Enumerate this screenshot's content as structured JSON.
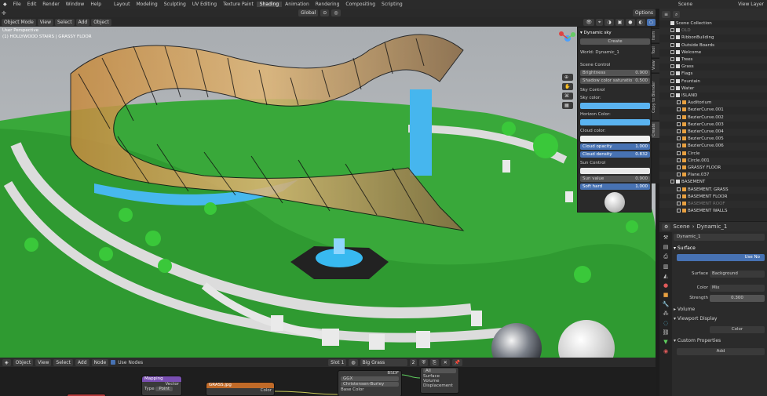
{
  "menu": {
    "items": [
      "File",
      "Edit",
      "Render",
      "Window",
      "Help"
    ],
    "workspaces": [
      "Layout",
      "Modeling",
      "Sculpting",
      "UV Editing",
      "Texture Paint",
      "Shading",
      "Animation",
      "Rendering",
      "Compositing",
      "Scripting"
    ],
    "active_workspace": "Shading",
    "scene_label": "Scene",
    "view_layer_label": "View Layer"
  },
  "viewport_header": {
    "mode": "Object Mode",
    "menus": [
      "View",
      "Select",
      "Add",
      "Object"
    ],
    "orientation": "Global",
    "options": "Options"
  },
  "viewport": {
    "title": "User Perspective",
    "subtitle": "(1) HOLLYWOOD STAIRS | GRASSY FLOOR"
  },
  "npanel": {
    "title": "Dynamic sky",
    "create_label": "Create",
    "world_label": "World: Dynamic_1",
    "scene_control": "Scene Control",
    "brightness_label": "Brightness",
    "brightness_value": "0.900",
    "shadow_label": "Shadow color saturatio",
    "shadow_value": "0.500",
    "sky_control": "Sky Control",
    "sky_color": "Sky color:",
    "horizon_color": "Horizon Color:",
    "cloud_color": "Cloud color:",
    "cloud_opacity_label": "Cloud opacity",
    "cloud_opacity_value": "1.000",
    "cloud_density_label": "Cloud density",
    "cloud_density_value": "0.832",
    "sun_control": "Sun Control",
    "sun_value_label": "Sun value",
    "sun_value_value": "0.900",
    "soft_hard_label": "Soft hard",
    "soft_hard_value": "1.000",
    "sky_color_hex": "#5ab3f0",
    "horizon_color_hex": "#5ab3f0",
    "cloud_color_hex": "#f0f0f0"
  },
  "vertical_tabs": [
    "Item",
    "Tool",
    "View",
    "Copy to Blender",
    "Create"
  ],
  "outliner": {
    "title": "Scene Collection",
    "rows": [
      {
        "label": "OLD",
        "indent": 1,
        "dim": true
      },
      {
        "label": "RibbonBuilding",
        "indent": 1
      },
      {
        "label": "Outside Boards",
        "indent": 1
      },
      {
        "label": "Welcome",
        "indent": 1
      },
      {
        "label": "Trees",
        "indent": 1
      },
      {
        "label": "Grass",
        "indent": 1
      },
      {
        "label": "Flags",
        "indent": 1
      },
      {
        "label": "Fountain",
        "indent": 1
      },
      {
        "label": "Water",
        "indent": 1
      },
      {
        "label": "ISLAND",
        "indent": 1
      },
      {
        "label": "Auditorium",
        "indent": 2
      },
      {
        "label": "BezierCurve.001",
        "indent": 2
      },
      {
        "label": "BezierCurve.002",
        "indent": 2
      },
      {
        "label": "BezierCurve.003",
        "indent": 2
      },
      {
        "label": "BezierCurve.004",
        "indent": 2
      },
      {
        "label": "BezierCurve.005",
        "indent": 2
      },
      {
        "label": "BezierCurve.006",
        "indent": 2
      },
      {
        "label": "Circle",
        "indent": 2
      },
      {
        "label": "Circle.001",
        "indent": 2
      },
      {
        "label": "GRASSY FLOOR",
        "indent": 2
      },
      {
        "label": "Plane.037",
        "indent": 2
      },
      {
        "label": "BASEMENT",
        "indent": 1
      },
      {
        "label": "BASEMENT. GRASS",
        "indent": 2
      },
      {
        "label": "BASEMENT FLOOR",
        "indent": 2
      },
      {
        "label": "BASEMENT ROOF",
        "indent": 2,
        "dim": true
      },
      {
        "label": "BASEMENT WALLS",
        "indent": 2
      }
    ]
  },
  "properties": {
    "scene": "Scene",
    "world": "Dynamic_1",
    "world_field": "Dynamic_1",
    "surface_section": "Surface",
    "use_nodes": "Use No",
    "surface_label": "Surface",
    "surface_value": "Background",
    "color_label": "Color",
    "color_value": "Mix",
    "strength_label": "Strength",
    "strength_value": "0.300",
    "volume_section": "Volume",
    "viewport_display_section": "Viewport Display",
    "vd_color": "Color",
    "custom_props_section": "Custom Properties",
    "add_label": "Add"
  },
  "node_editor": {
    "type": "Object",
    "menus": [
      "View",
      "Select",
      "Add",
      "Node"
    ],
    "use_nodes": "Use Nodes",
    "slot": "Slot 1",
    "material": "Big Grass",
    "users": "2",
    "nodes": {
      "mapping": "Mapping",
      "mapping_vector": "Vector",
      "mapping_type_label": "Type",
      "mapping_type_value": "Point",
      "image": "GRASS.jpg",
      "image_color": "Color",
      "bsdf_dist": "GGX",
      "bsdf_sss": "Christensen-Burley",
      "bsdf_base": "Base Color",
      "bsdf_label": "BSDF",
      "output_all": "All",
      "output_surface": "Surface",
      "output_volume": "Volume",
      "output_displacement": "Displacement"
    }
  }
}
